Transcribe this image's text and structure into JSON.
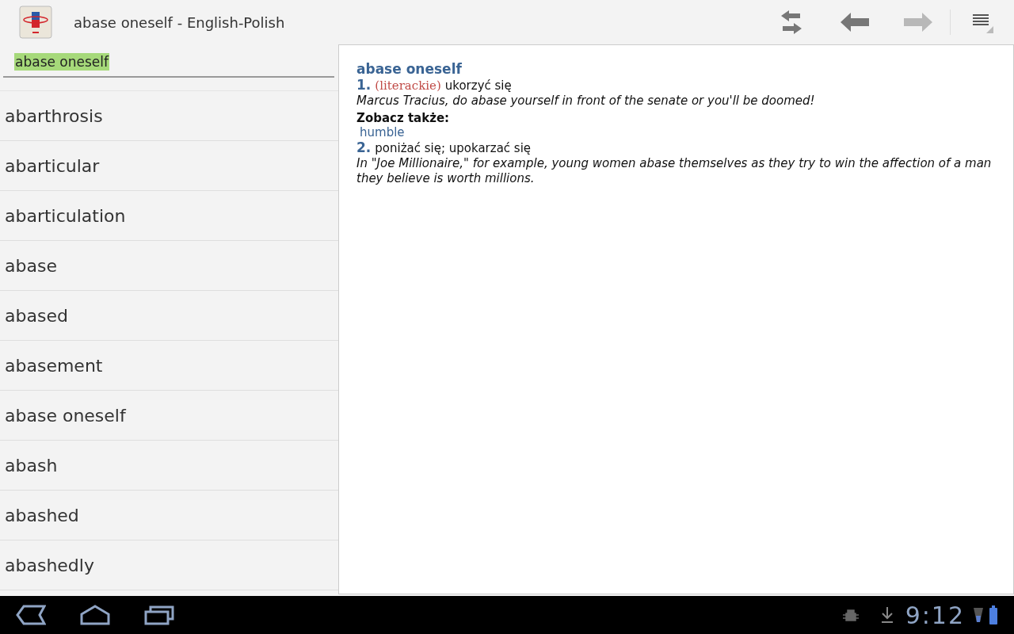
{
  "action_bar": {
    "title": "abase oneself - English-Polish",
    "actions": [
      {
        "kind": "swap",
        "disabled": false
      },
      {
        "kind": "back",
        "disabled": false
      },
      {
        "kind": "forward",
        "disabled": true
      },
      {
        "kind": "menu",
        "disabled": false
      }
    ]
  },
  "search": {
    "value": "abase oneself"
  },
  "word_list": [
    "abarthrosis",
    "abarticular",
    "abarticulation",
    "abase",
    "abased",
    "abasement",
    "abase oneself",
    "abash",
    "abashed",
    "abashedly"
  ],
  "entry": {
    "headword": "abase oneself",
    "blocks": [
      {
        "kind": "sense",
        "number": "1.",
        "register": "(literackie)",
        "translation": "ukorzyć się",
        "example": "Marcus Tracius, do abase yourself in front of the senate or you'll be doomed!"
      },
      {
        "kind": "see_also",
        "heading": "Zobacz także:",
        "links": [
          "humble"
        ]
      },
      {
        "kind": "sense",
        "number": "2.",
        "translation": "poniżać się; upokarzać się",
        "example": "In \"Joe Millionaire,\" for example, young women abase themselves as they try to win the affection of a man they believe is worth millions."
      }
    ]
  },
  "system_bar": {
    "time": "9:12"
  }
}
